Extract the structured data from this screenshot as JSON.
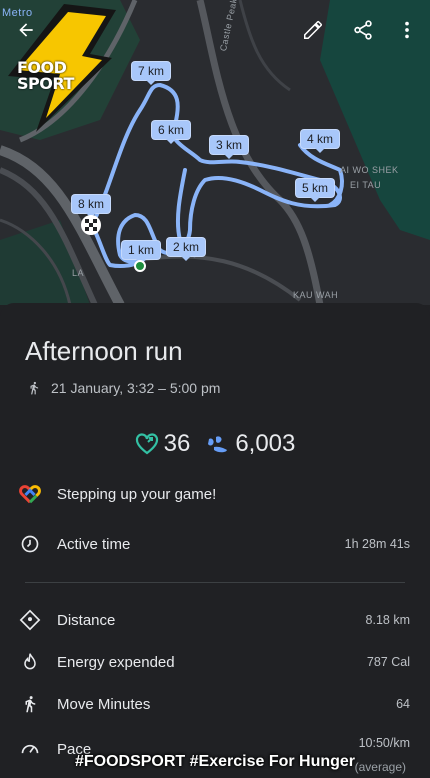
{
  "map": {
    "place_labels": [
      "Metro",
      "Castle Peak Rd - Kwai",
      "AI WO SHEK",
      "EI TAU",
      "KAU WAH",
      "LA"
    ],
    "km_markers": [
      "7 km",
      "6 km",
      "3 km",
      "4 km",
      "5 km",
      "8 km",
      "1 km",
      "2 km"
    ]
  },
  "logo": {
    "text_line1": "FOOD",
    "text_line2": "SPORT"
  },
  "toolbar": {
    "back_icon": "arrow-left-icon",
    "edit_icon": "pencil-icon",
    "share_icon": "share-icon",
    "more_icon": "more-vert-icon"
  },
  "activity": {
    "title": "Afternoon run",
    "datetime": "21 January, 3:32 – 5:00 pm",
    "heart_points": "36",
    "steps": "6,003"
  },
  "rows": {
    "goal": "Stepping up your game!",
    "active_time_label": "Active time",
    "active_time_value": "1h 28m 41s",
    "distance_label": "Distance",
    "distance_value": "8.18 km",
    "energy_label": "Energy expended",
    "energy_value": "787 Cal",
    "move_label": "Move Minutes",
    "move_value": "64",
    "pace_label": "Pace",
    "pace_value": "10:50/km",
    "pace_note": "(average)"
  },
  "overlay": {
    "hashtag": "#FOODSPORT #Exercise For Hunger"
  },
  "colors": {
    "route": "#8ab4f8",
    "accent_green": "#33c1a4",
    "accent_blue": "#669df6",
    "bg": "#202124"
  }
}
